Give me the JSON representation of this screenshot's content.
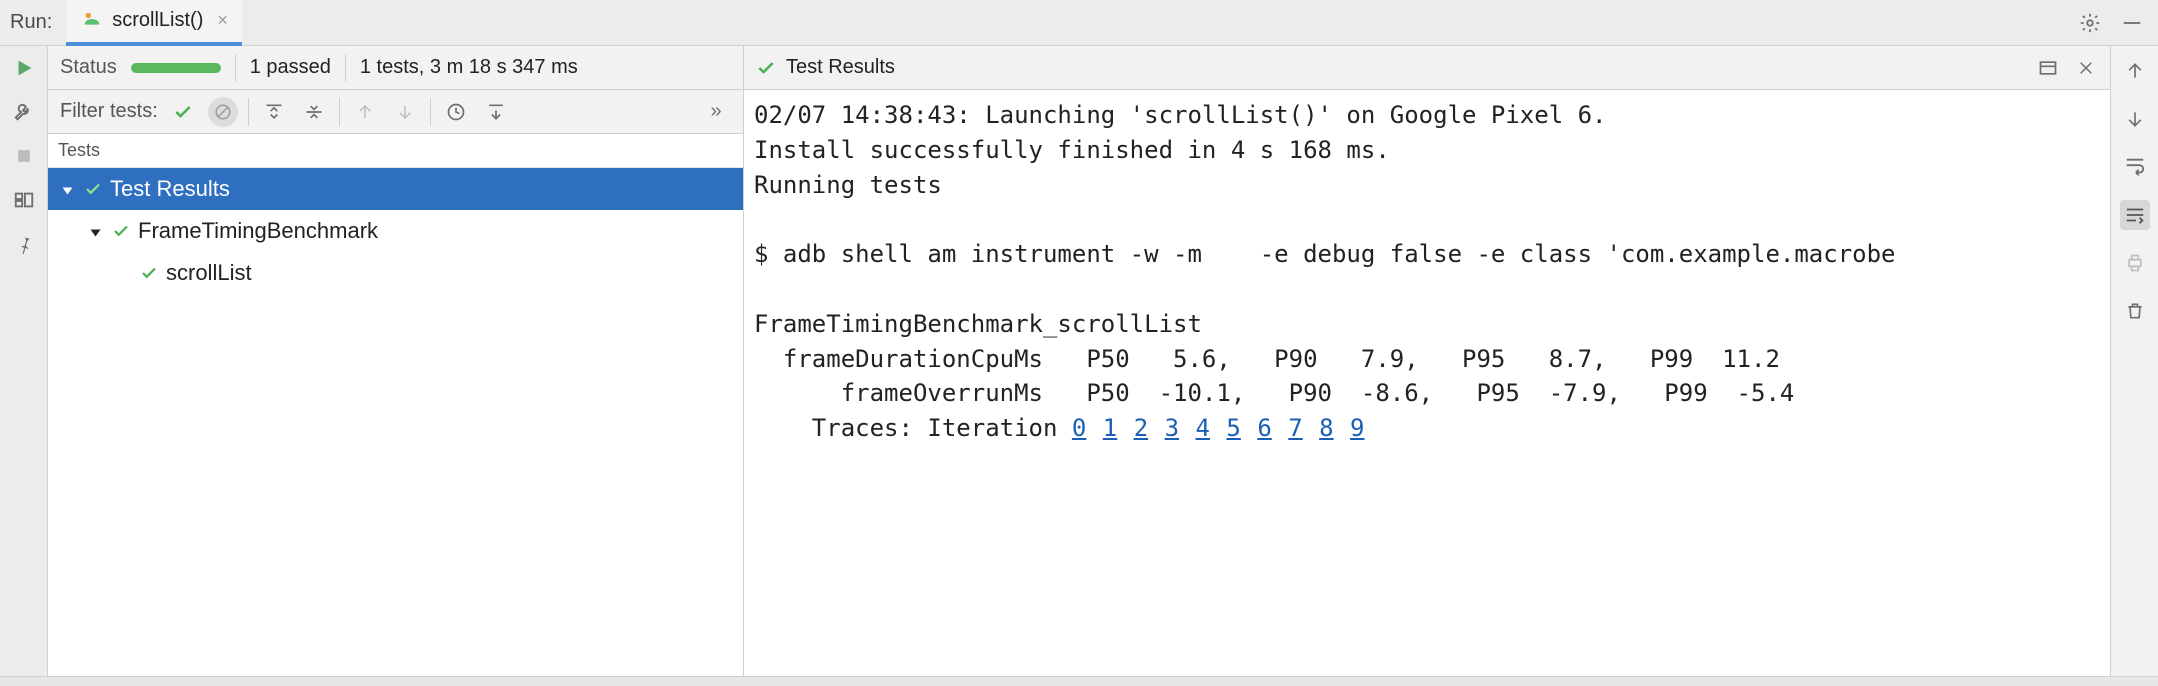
{
  "header": {
    "run_label": "Run:",
    "tab_name": "scrollList()"
  },
  "status": {
    "label": "Status",
    "pass_count": "1 passed",
    "timing": "1 tests, 3 m 18 s 347 ms"
  },
  "filter": {
    "label": "Filter tests:"
  },
  "tree": {
    "header": "Tests",
    "nodes": [
      {
        "label": "Test Results",
        "depth": 0,
        "expandable": true,
        "selected": true
      },
      {
        "label": "FrameTimingBenchmark",
        "depth": 1,
        "expandable": true,
        "selected": false
      },
      {
        "label": "scrollList",
        "depth": 2,
        "expandable": false,
        "selected": false
      }
    ]
  },
  "console": {
    "title": "Test Results",
    "lines": [
      "02/07 14:38:43: Launching 'scrollList()' on Google Pixel 6.",
      "Install successfully finished in 4 s 168 ms.",
      "Running tests",
      "",
      "$ adb shell am instrument -w -m    -e debug false -e class 'com.example.macrobe",
      "",
      "FrameTimingBenchmark_scrollList",
      "  frameDurationCpuMs   P50   5.6,   P90   7.9,   P95   8.7,   P99  11.2",
      "      frameOverrunMs   P50  -10.1,   P90  -8.6,   P95  -7.9,   P99  -5.4",
      "    Traces: Iteration "
    ],
    "trace_links": [
      "0",
      "1",
      "2",
      "3",
      "4",
      "5",
      "6",
      "7",
      "8",
      "9"
    ]
  },
  "colors": {
    "pass_green": "#4caf50",
    "selection_blue": "#2e6fc0",
    "link_blue": "#1a5fb4"
  }
}
